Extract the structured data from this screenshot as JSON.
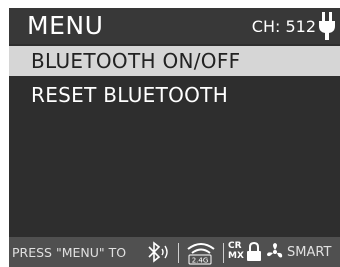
{
  "header": {
    "title": "MENU",
    "channel": "CH: 512"
  },
  "menu": {
    "items": [
      {
        "label": "BLUETOOTH ON/OFF",
        "selected": true
      },
      {
        "label": "RESET BLUETOOTH",
        "selected": false
      }
    ]
  },
  "status_bar": {
    "hint": "PRESS \"MENU\" TO",
    "wifi_band": "2.4G",
    "crmx_top": "CR",
    "crmx_bottom": "MX",
    "smart": "SMART"
  },
  "icons": {
    "power": "plug-icon",
    "bluetooth": "bluetooth-icon",
    "wireless": "wireless-icon",
    "crmx": "crmx-icon",
    "lock": "lock-icon",
    "fan": "fan-icon"
  },
  "colors": {
    "screen_background": "#2e2e2e",
    "header_background": "#383838",
    "selected_row": "#d6d6d6",
    "status_bar": "#505050",
    "text": "#ffffff"
  }
}
